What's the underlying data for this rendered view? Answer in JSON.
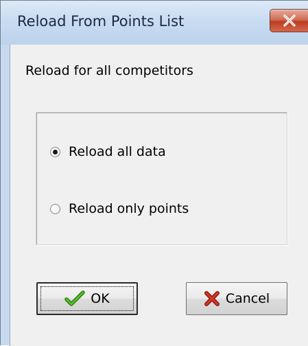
{
  "window": {
    "title": "Reload From Points List"
  },
  "titlebar": {
    "close_icon": "close-icon"
  },
  "dialog": {
    "info_label": "Reload for all competitors",
    "options": [
      {
        "label": "Reload all data",
        "selected": true
      },
      {
        "label": "Reload only points",
        "selected": false
      }
    ]
  },
  "buttons": {
    "ok_label": "OK",
    "ok_icon": "checkmark-icon",
    "cancel_label": "Cancel",
    "cancel_icon": "x-mark-icon"
  },
  "colors": {
    "close_button": "#c8503a",
    "ok_check": "#3a9a1e",
    "cancel_x": "#c0281c"
  }
}
